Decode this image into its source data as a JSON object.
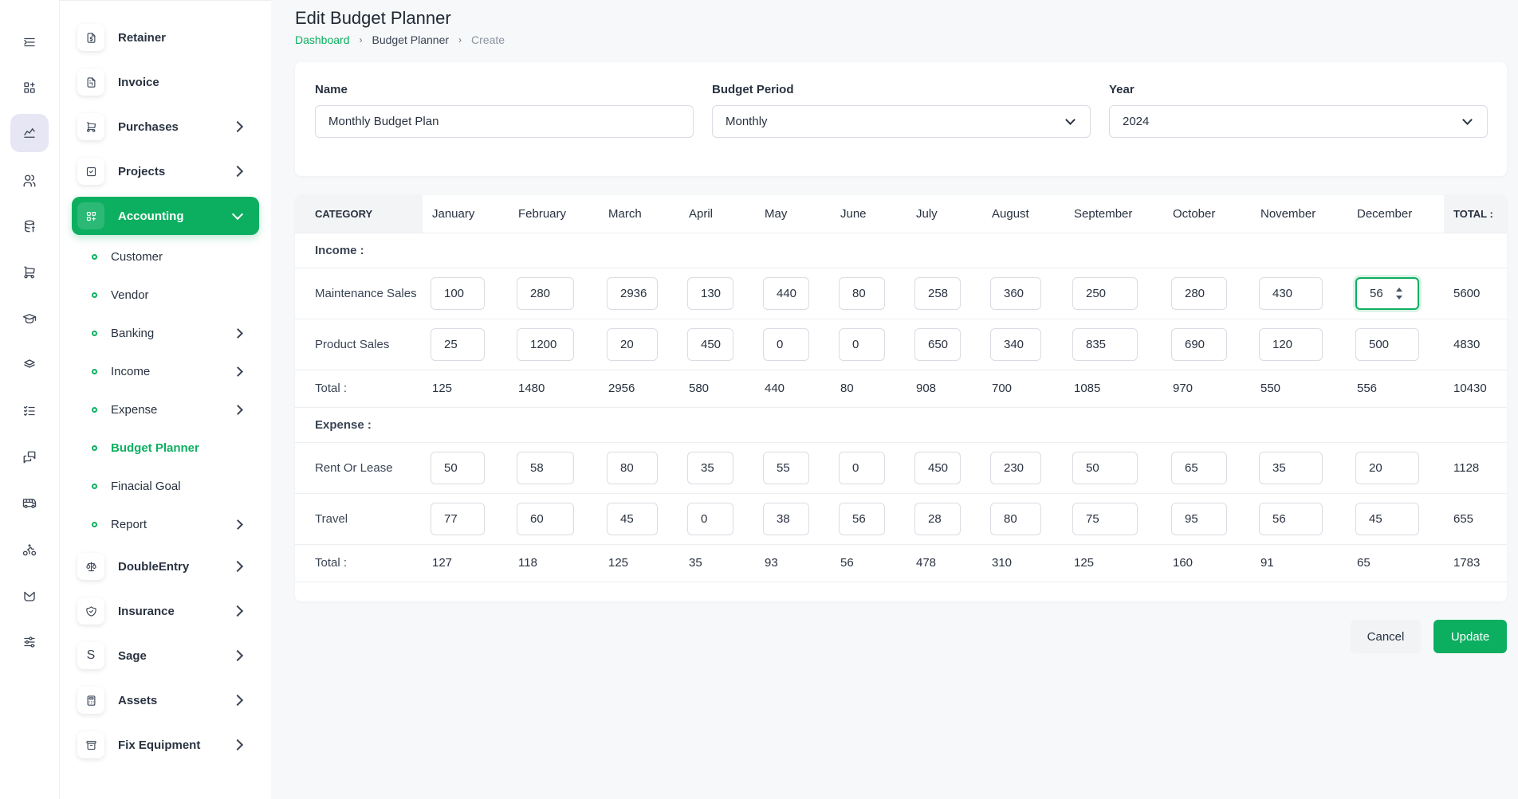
{
  "rail": {
    "items": [
      "menu-collapse-icon",
      "apps-icon",
      "chart-line-icon",
      "users-icon",
      "database-dollar-icon",
      "cart-icon",
      "graduation-cap-icon",
      "layers-icon",
      "checklist-icon",
      "messages-icon",
      "bus-icon",
      "bike-icon",
      "mailbox-icon",
      "adjustments-icon"
    ]
  },
  "sidebar": {
    "items": [
      {
        "label": "Retainer",
        "icon": "file-dollar-icon"
      },
      {
        "label": "Invoice",
        "icon": "file-invoice-icon"
      },
      {
        "label": "Purchases",
        "icon": "shopping-cart-icon"
      },
      {
        "label": "Projects",
        "icon": "square-check-icon"
      },
      {
        "label": "Accounting",
        "icon": "layout-grid-add-icon"
      },
      {
        "label": "DoubleEntry",
        "icon": "scale-icon"
      },
      {
        "label": "Insurance",
        "icon": "shield-check-icon"
      },
      {
        "label": "Sage",
        "icon": "letter-s-icon",
        "glyph": "S"
      },
      {
        "label": "Assets",
        "icon": "calculator-icon"
      },
      {
        "label": "Fix Equipment",
        "icon": "archive-icon"
      }
    ],
    "subitems": [
      {
        "label": "Customer"
      },
      {
        "label": "Vendor"
      },
      {
        "label": "Banking"
      },
      {
        "label": "Income"
      },
      {
        "label": "Expense"
      },
      {
        "label": "Budget Planner"
      },
      {
        "label": "Finacial Goal"
      },
      {
        "label": "Report"
      }
    ]
  },
  "header": {
    "title": "Edit Budget Planner",
    "breadcrumb": [
      "Dashboard",
      "Budget Planner",
      "Create"
    ]
  },
  "form": {
    "name_label": "Name",
    "name_value": "Monthly Budget Plan",
    "period_label": "Budget Period",
    "period_value": "Monthly",
    "year_label": "Year",
    "year_value": "2024"
  },
  "table": {
    "category_header": "CATEGORY",
    "months": [
      "January",
      "February",
      "March",
      "April",
      "May",
      "June",
      "July",
      "August",
      "September",
      "October",
      "November",
      "December"
    ],
    "total_header": "TOTAL :",
    "income_label": "Income :",
    "income_rows": [
      {
        "label": "Maintenance Sales",
        "values": [
          "100",
          "280",
          "2936",
          "130",
          "440",
          "80",
          "258",
          "360",
          "250",
          "280",
          "430",
          "56"
        ],
        "total": "5600"
      },
      {
        "label": "Product Sales",
        "values": [
          "25",
          "1200",
          "20",
          "450",
          "0",
          "0",
          "650",
          "340",
          "835",
          "690",
          "120",
          "500"
        ],
        "total": "4830"
      }
    ],
    "income_total": {
      "label": "Total :",
      "values": [
        "125",
        "1480",
        "2956",
        "580",
        "440",
        "80",
        "908",
        "700",
        "1085",
        "970",
        "550",
        "556"
      ],
      "total": "10430"
    },
    "expense_label": "Expense :",
    "expense_rows": [
      {
        "label": "Rent Or Lease",
        "values": [
          "50",
          "58",
          "80",
          "35",
          "55",
          "0",
          "450",
          "230",
          "50",
          "65",
          "35",
          "20"
        ],
        "total": "1128"
      },
      {
        "label": "Travel",
        "values": [
          "77",
          "60",
          "45",
          "0",
          "38",
          "56",
          "28",
          "80",
          "75",
          "95",
          "56",
          "45"
        ],
        "total": "655"
      }
    ],
    "expense_total": {
      "label": "Total :",
      "values": [
        "127",
        "118",
        "125",
        "35",
        "93",
        "56",
        "478",
        "310",
        "125",
        "160",
        "91",
        "65"
      ],
      "total": "1783"
    }
  },
  "actions": {
    "cancel": "Cancel",
    "update": "Update"
  },
  "colors": {
    "accent": "#0caf60",
    "rail_active": "#e6e6f5"
  }
}
